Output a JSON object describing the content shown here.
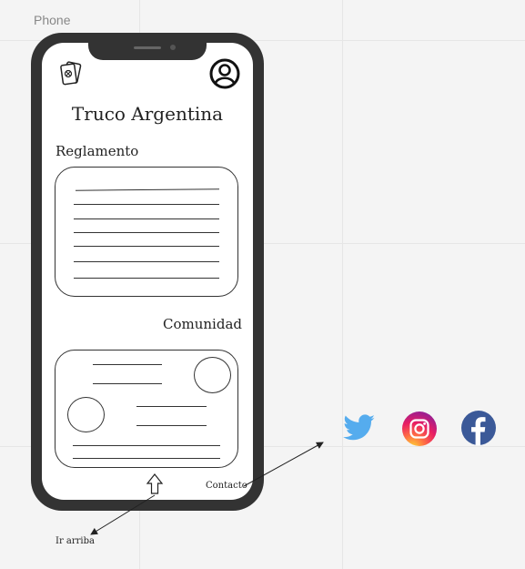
{
  "frame": {
    "label": "Phone"
  },
  "app": {
    "title": "Truco Argentina"
  },
  "sections": {
    "rules_label": "Reglamento",
    "community_label": "Comunidad"
  },
  "annotations": {
    "back_to_top": "Ir arriba",
    "contact": "Contacto"
  },
  "icons": {
    "logo": "playing-cards-icon",
    "profile": "user-circle-icon",
    "scroll_top": "arrow-up-icon",
    "social": [
      "twitter-icon",
      "instagram-icon",
      "facebook-icon"
    ]
  },
  "colors": {
    "twitter": "#55acee",
    "facebook": "#3b5998",
    "phone_body": "#333333"
  }
}
